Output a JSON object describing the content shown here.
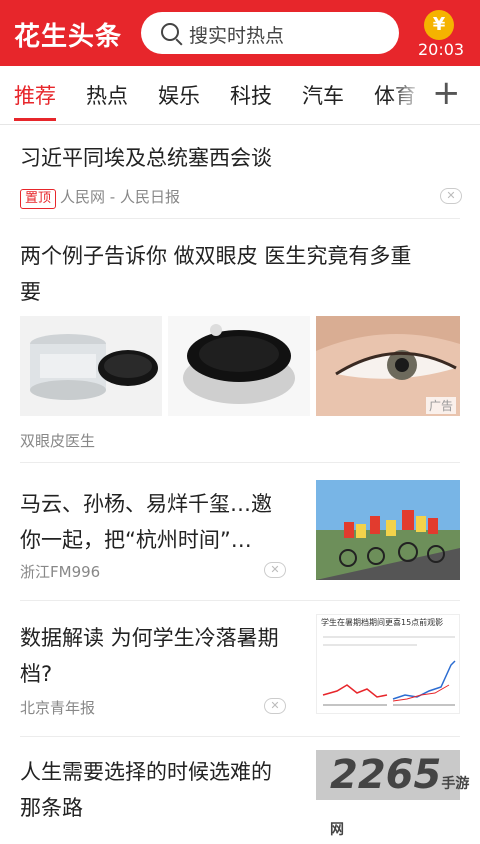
{
  "app": {
    "logo": "花生头条",
    "time": "20:03",
    "coin_glyph": "¥"
  },
  "search": {
    "placeholder": "搜实时热点"
  },
  "tabs": [
    "推荐",
    "热点",
    "娱乐",
    "科技",
    "汽车",
    "体育"
  ],
  "articles": [
    {
      "title": "习近平同埃及总统塞西会谈",
      "pin_label": "置顶",
      "source": "人民网 - 人民日报"
    },
    {
      "title_line1": "两个例子告诉你 做双眼皮 医生究竟有多重",
      "title_line2": "要",
      "source": "双眼皮医生",
      "ad_label": "广告"
    },
    {
      "title_line1": "马云、孙杨、易烊千玺…邀",
      "title_line2": "你一起，把“杭州时间”…",
      "source": "浙江FM996"
    },
    {
      "title_line1": "数据解读 为何学生冷落暑期",
      "title_line2": "档?",
      "source": "北京青年报",
      "thumb_heading": "学生在暑期档期间更喜15点前观影"
    },
    {
      "title_line1": "人生需要选择的时候选难的",
      "title_line2": "那条路"
    }
  ],
  "watermark": {
    "brand": "2265",
    "sub": "手游网"
  },
  "colors": {
    "brand_red": "#e7262b",
    "coin": "#f5b300"
  }
}
